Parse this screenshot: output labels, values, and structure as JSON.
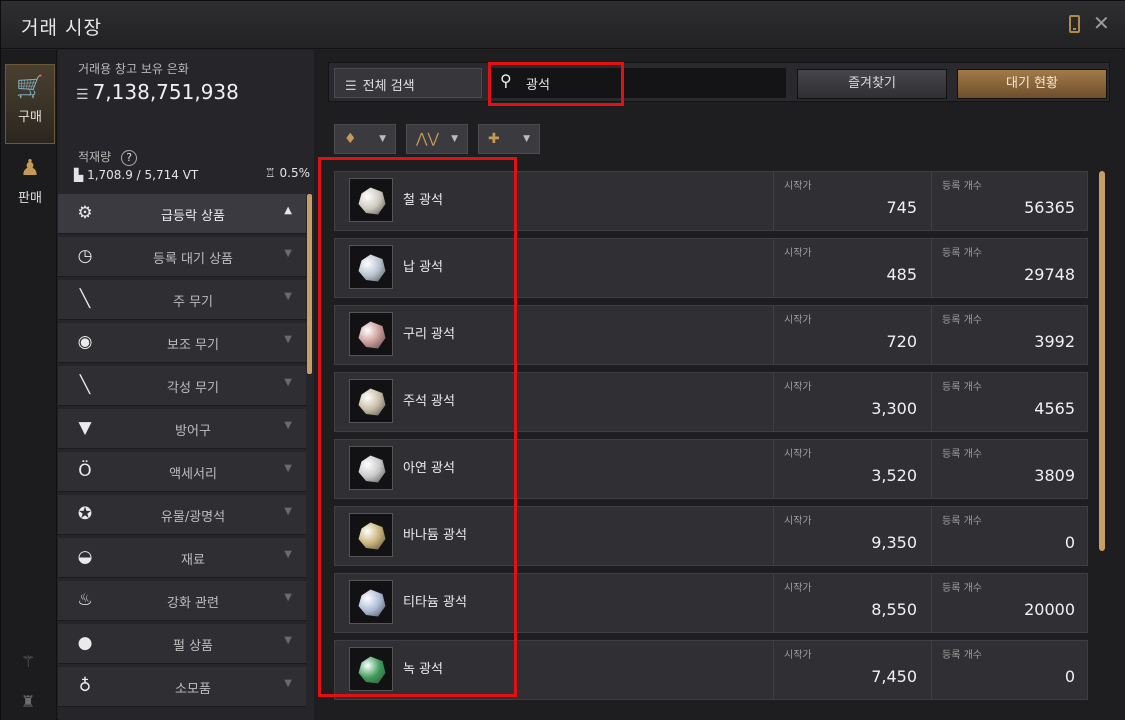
{
  "window": {
    "title": "거래 시장"
  },
  "rail": {
    "tabs": [
      {
        "label": "구매",
        "icon": "cart-icon"
      },
      {
        "label": "판매",
        "icon": "sell-icon"
      }
    ]
  },
  "info": {
    "silver_label": "거래용 창고 보유 은화",
    "silver_value": "7,138,751,938",
    "weight_label": "적재량",
    "weight_help": "?",
    "weight_value": "1,708.9 / 5,714 VT",
    "tax_value": "0.5%"
  },
  "categories": [
    {
      "label": "급등락 상품",
      "icon": "gear-icon",
      "glyph": "⚙",
      "active": true
    },
    {
      "label": "등록 대기 상품",
      "icon": "clock-icon",
      "glyph": "◷",
      "active": false
    },
    {
      "label": "주 무기",
      "icon": "sword-icon",
      "glyph": "╲",
      "active": false
    },
    {
      "label": "보조 무기",
      "icon": "shield-icon",
      "glyph": "◉",
      "active": false
    },
    {
      "label": "각성 무기",
      "icon": "great-sword-icon",
      "glyph": "╲",
      "active": false
    },
    {
      "label": "방어구",
      "icon": "armor-icon",
      "glyph": "▼",
      "active": false
    },
    {
      "label": "액세서리",
      "icon": "ring-icon",
      "glyph": "Ö",
      "active": false
    },
    {
      "label": "유물/광명석",
      "icon": "relic-icon",
      "glyph": "✪",
      "active": false
    },
    {
      "label": "재료",
      "icon": "material-icon",
      "glyph": "◒",
      "active": false
    },
    {
      "label": "강화 관련",
      "icon": "flame-icon",
      "glyph": "♨",
      "active": false
    },
    {
      "label": "펄 상품",
      "icon": "pearl-icon",
      "glyph": "●",
      "active": false
    },
    {
      "label": "소모품",
      "icon": "potion-icon",
      "glyph": "♁",
      "active": false
    }
  ],
  "search": {
    "type_label": "전체 검색",
    "query": "광석",
    "favorites_label": "즐겨찾기",
    "waiting_label": "대기 현황"
  },
  "filters": [
    {
      "icon": "bag-icon",
      "glyph": "♦"
    },
    {
      "icon": "trend-icon",
      "glyph": "⋀⋁"
    },
    {
      "icon": "plus-icon",
      "glyph": "✚"
    }
  ],
  "columns": {
    "price": "시작가",
    "count": "등록 개수"
  },
  "items": [
    {
      "name": "철 광석",
      "price": "745",
      "count": "56365",
      "color": "#cfc9be"
    },
    {
      "name": "납 광석",
      "price": "485",
      "count": "29748",
      "color": "#b9c3cf"
    },
    {
      "name": "구리 광석",
      "price": "720",
      "count": "3992",
      "color": "#c99a96"
    },
    {
      "name": "주석 광석",
      "price": "3,300",
      "count": "4565",
      "color": "#c7bda6"
    },
    {
      "name": "아연 광석",
      "price": "3,520",
      "count": "3809",
      "color": "#c9c9c9"
    },
    {
      "name": "바나듐 광석",
      "price": "9,350",
      "count": "0",
      "color": "#c8b277"
    },
    {
      "name": "티타늄 광석",
      "price": "8,550",
      "count": "20000",
      "color": "#aebbd6"
    },
    {
      "name": "녹 광석",
      "price": "7,450",
      "count": "0",
      "color": "#3d9d5a"
    }
  ],
  "colors": {
    "accent": "#c79e64",
    "highlight": "#e30f12"
  }
}
